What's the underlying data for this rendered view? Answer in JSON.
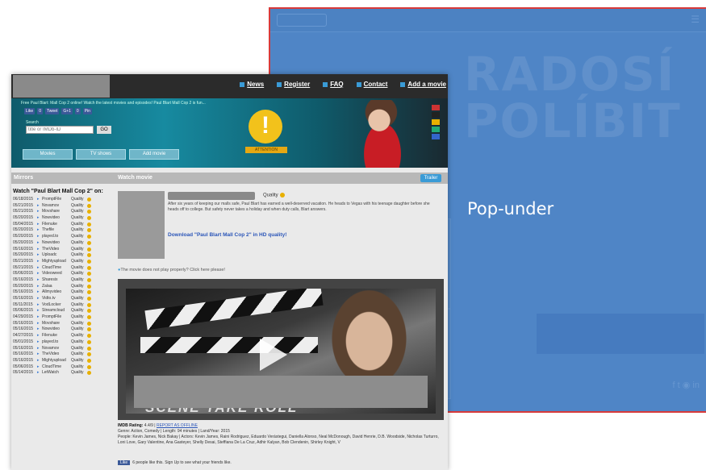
{
  "popunder": {
    "big_text_line1": "RADOSÍ",
    "big_text_line2": "POLÍBIT",
    "label": "Pop-under",
    "social": "f  t  ◉  in"
  },
  "site": {
    "nav": [
      "News",
      "Register",
      "FAQ",
      "Contact",
      "Add a movie"
    ],
    "tagline": "Free Paul Blart: Mall Cop 2 online! Watch the latest movies and episodes! Paul Blart Mall Cop 2 is fun...",
    "share_buttons": [
      "Like",
      "0",
      "Tweet",
      "G+1",
      "0",
      "Pin"
    ],
    "search_label": "Search",
    "search_placeholder": "title or IMDb-ID",
    "search_button": "GO",
    "categories": [
      "Movies",
      "TV shows",
      "Add movie"
    ],
    "attention_symbol": "!",
    "attention_label": "ATTENTION",
    "section_left": "Mirrors",
    "section_right": "Watch movie",
    "trailer_button": "Trailer",
    "list_title": "Watch \"Paul Blart Mall Cop 2\" on:",
    "mirrors": [
      {
        "date": "06/18/2015",
        "host": "PromptFile",
        "q": "Quality"
      },
      {
        "date": "05/21/2015",
        "host": "Novamov",
        "q": "Quality"
      },
      {
        "date": "05/21/2015",
        "host": "Movshare",
        "q": "Quality"
      },
      {
        "date": "05/20/2015",
        "host": "Nowvideo",
        "q": "Quality"
      },
      {
        "date": "05/04/2015",
        "host": "Filenuke",
        "q": "Quality"
      },
      {
        "date": "05/20/2015",
        "host": "Thefile",
        "q": "Quality"
      },
      {
        "date": "05/20/2015",
        "host": "played.to",
        "q": "Quality"
      },
      {
        "date": "05/20/2015",
        "host": "Nowvideo",
        "q": "Quality"
      },
      {
        "date": "05/16/2015",
        "host": "TheVideo",
        "q": "Quality"
      },
      {
        "date": "05/20/2015",
        "host": "Uploadc",
        "q": "Quality"
      },
      {
        "date": "05/21/2015",
        "host": "Mightyupload",
        "q": "Quality"
      },
      {
        "date": "05/21/2015",
        "host": "CloudTime",
        "q": "Quality"
      },
      {
        "date": "05/06/2015",
        "host": "Videoweed",
        "q": "Quality"
      },
      {
        "date": "05/16/2015",
        "host": "Sharesix",
        "q": "Quality"
      },
      {
        "date": "05/20/2015",
        "host": "Zalaa",
        "q": "Quality"
      },
      {
        "date": "05/16/2015",
        "host": "Allmyvideo",
        "q": "Quality"
      },
      {
        "date": "05/16/2015",
        "host": "Vidto.tv",
        "q": "Quality"
      },
      {
        "date": "05/11/2015",
        "host": "VodLocker",
        "q": "Quality"
      },
      {
        "date": "05/06/2015",
        "host": "Streamcloud",
        "q": "Quality"
      },
      {
        "date": "04/29/2015",
        "host": "PromptFile",
        "q": "Quality"
      },
      {
        "date": "05/16/2015",
        "host": "Movshare",
        "q": "Quality"
      },
      {
        "date": "05/16/2015",
        "host": "Nowvideo",
        "q": "Quality"
      },
      {
        "date": "04/27/2015",
        "host": "Filenuke",
        "q": "Quality"
      },
      {
        "date": "05/01/2015",
        "host": "played.to",
        "q": "Quality"
      },
      {
        "date": "05/16/2015",
        "host": "Novamov",
        "q": "Quality"
      },
      {
        "date": "05/16/2015",
        "host": "TheVideo",
        "q": "Quality"
      },
      {
        "date": "05/16/2015",
        "host": "Mightyupload",
        "q": "Quality"
      },
      {
        "date": "05/06/2015",
        "host": "CloudTime",
        "q": "Quality"
      },
      {
        "date": "05/14/2015",
        "host": "LetWatch",
        "q": "Quality"
      }
    ],
    "quality_label": "Quality",
    "description": "After six years of keeping our malls safe, Paul Blart has earned a well-deserved vacation. He heads to Vegas with his teenage daughter before she heads off to college. But safety never takes a holiday and when duty calls, Blart answers.",
    "download_link": "Download \"Paul Blart Mall Cop 2\" in HD quality!",
    "notice": "The movie does not play properly? Click here please!",
    "video_caption": "SCENE    TAKE    ROLL",
    "imdb_label": "IMDB Rating:",
    "imdb_value": "4.4/9",
    "report_link": "REPORT AS OFFLINE",
    "genre_line": "Genre: Action, Comedy | Length: 94 minutes | Land/Year: 2015",
    "people_line": "People: Kevin James, Nick Bakay | Actors: Kevin James, Raini Rodriguez, Eduardo Verástegui, Daniella Alonso, Neal McDonough, David Henrie, D.B. Woodside, Nicholas Turturro, Loni Love, Gary Valentine, Ana Gasteyer, Shelly Desai, Steffiana De La Cruz, Adhir Kalyan, Bob Clendenin, Shirley Knight, V",
    "like_button": "Like",
    "like_text": "6 people like this. Sign Up to see what your friends like."
  }
}
